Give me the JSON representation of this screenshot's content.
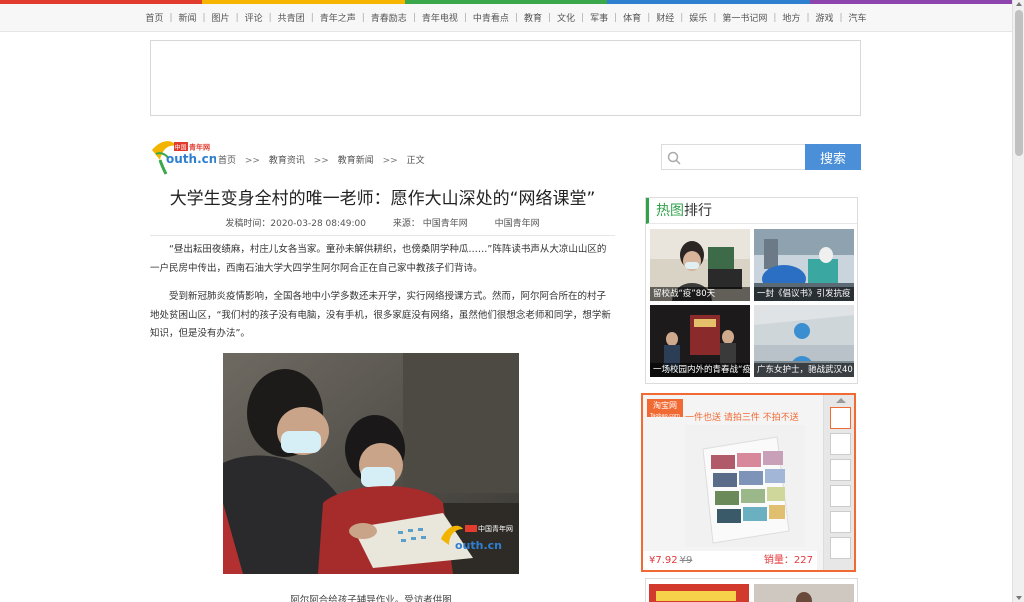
{
  "nav": {
    "items": [
      "首页",
      "新闻",
      "图片",
      "评论",
      "共青团",
      "青年之声",
      "青春励志",
      "青年电视",
      "中青看点",
      "教育",
      "文化",
      "军事",
      "体育",
      "财经",
      "娱乐",
      "第一书记网",
      "地方",
      "游戏",
      "汽车"
    ]
  },
  "logo": {
    "badge": "中国青年网",
    "text": "outh.cn"
  },
  "breadcrumb": {
    "items": [
      "首页",
      "教育资讯",
      "教育新闻",
      "正文"
    ],
    "separator": ">>"
  },
  "article": {
    "title": "大学生变身全村的唯一老师：愿作大山深处的“网络课堂”",
    "meta": {
      "date": "发稿时间：2020-03-28 08:49:00",
      "source": "来源：  中国青年网",
      "author": "中国青年网"
    },
    "paragraphs": [
      "“昼出耘田夜绩麻，村庄儿女各当家。童孙未解供耕织，也傍桑阴学种瓜……”阵阵读书声从大凉山山区的一户民房中传出，西南石油大学大四学生阿尔阿合正在自己家中教孩子们背诗。",
      "受到新冠肺炎疫情影响，全国各地中小学多数还未开学，实行网络授课方式。然而，阿尔阿合所在的村子地处贫困山区，“我们村的孩子没有电脑，没有手机，很多家庭没有网络，虽然他们很想念老师和同学，想学新知识，但是没有办法”。"
    ],
    "photo_caption": "阿尔阿合给孩子辅导作业。受访者供图",
    "photo_watermark": "中国青年网"
  },
  "search": {
    "placeholder": "",
    "button": "搜索"
  },
  "hot": {
    "title_green": "热图",
    "title_rest": "排行",
    "items": [
      {
        "caption": "留校战“疫”80天"
      },
      {
        "caption": "一封《倡议书》引发抗疫"
      },
      {
        "caption": "一场校园内外的青春战“疫”"
      },
      {
        "caption": "广东女护士，驰战武汉40"
      }
    ]
  },
  "taobao": {
    "logo_line1": "淘宝网",
    "logo_line2": "Taobao.com",
    "slogan": "一件也送 请拍三件 不拍不送",
    "price": "¥7.92",
    "old_price": "¥9",
    "sales": "销量：227"
  },
  "colors": {
    "strip": [
      "#e23c2f",
      "#f7b500",
      "#3aa74a",
      "#2f7fd1",
      "#8e44ad"
    ],
    "search_button": "#4a8fd8",
    "hot_accent": "#2fa34a",
    "taobao_orange": "#f26a33"
  }
}
